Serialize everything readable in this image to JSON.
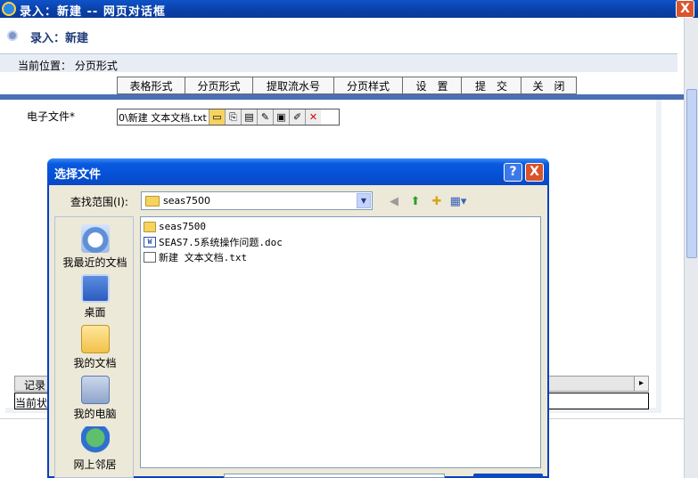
{
  "window": {
    "title": "录入：新建 -- 网页对话框",
    "close_label": "X"
  },
  "page": {
    "heading": "录入：新建",
    "breadcrumb_label": "当前位置：",
    "breadcrumb_value": "分页形式"
  },
  "toolbar": {
    "items": [
      "表格形式",
      "分页形式",
      "提取流水号",
      "分页样式",
      "设　置",
      "提　交",
      "关　闭"
    ]
  },
  "form": {
    "file_label": "电子文件*",
    "file_value": "0\\新建 文本文档.txt",
    "record_label": "记录",
    "status_label": "当前状"
  },
  "dialog": {
    "title": "选择文件",
    "help_label": "?",
    "close_label": "X",
    "lookin_label": "查找范围(I):",
    "lookin_value": "seas7500",
    "places": [
      {
        "label": "我最近的文档",
        "icon": "recent-documents-icon"
      },
      {
        "label": "桌面",
        "icon": "desktop-icon"
      },
      {
        "label": "我的文档",
        "icon": "my-documents-icon"
      },
      {
        "label": "我的电脑",
        "icon": "my-computer-icon"
      },
      {
        "label": "网上邻居",
        "icon": "network-places-icon"
      }
    ],
    "files": [
      {
        "name": "seas7500",
        "type": "folder"
      },
      {
        "name": "SEAS7.5系统操作问题.doc",
        "type": "word"
      },
      {
        "name": "新建 文本文档.txt",
        "type": "text"
      }
    ]
  }
}
